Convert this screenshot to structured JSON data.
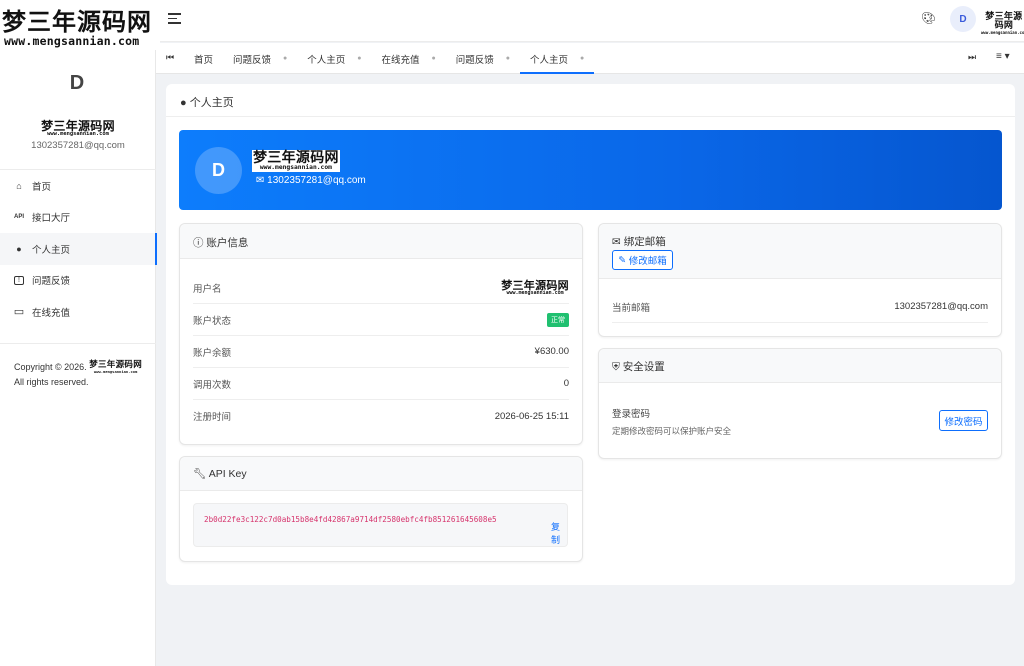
{
  "brand": {
    "main": "梦三年源码网",
    "sub": "www.mengsannian.com",
    "mini_main": "梦三年源码网",
    "mini_sub": "www.mengsannian.com"
  },
  "sidebar": {
    "avatar_letter": "D",
    "email": "1302357281@qq.com",
    "items": [
      {
        "icon": "home-icon",
        "glyph": "⌂",
        "label": "首页"
      },
      {
        "icon": "api-icon",
        "glyph": "API",
        "label": "接口大厅"
      },
      {
        "icon": "user-circle-icon",
        "glyph": "●",
        "label": "个人主页",
        "active": true
      },
      {
        "icon": "feedback-icon",
        "glyph": "!",
        "label": "问题反馈"
      },
      {
        "icon": "card-icon",
        "glyph": "▭",
        "label": "在线充值"
      }
    ],
    "copyright_prefix": "Copyright © 2026.",
    "copyright_suffix": "All rights reserved."
  },
  "topbar": {
    "avatar_letter": "D"
  },
  "tabs": [
    {
      "label": "首页",
      "closable": false
    },
    {
      "label": "问题反馈",
      "closable": true
    },
    {
      "label": "个人主页",
      "closable": true
    },
    {
      "label": "在线充值",
      "closable": true
    },
    {
      "label": "问题反馈",
      "closable": true
    },
    {
      "label": "个人主页",
      "closable": true,
      "active": true
    }
  ],
  "page": {
    "title": "个人主页",
    "hero": {
      "avatar_letter": "D",
      "email": "1302357281@qq.com"
    },
    "account": {
      "title": "账户信息",
      "rows": [
        {
          "label": "用户名",
          "value": ""
        },
        {
          "label": "账户状态",
          "value": "正常"
        },
        {
          "label": "账户余额",
          "value": "¥630.00"
        },
        {
          "label": "调用次数",
          "value": "0"
        },
        {
          "label": "注册时间",
          "value": "2026-06-25 15:11"
        }
      ]
    },
    "apikey": {
      "title": "API Key",
      "key": "2b0d22fe3c122c7d0ab15b8e4fd42867a9714df2580ebfc4fb851261645608e5",
      "copy_label": "复制"
    },
    "email_card": {
      "title": "绑定邮箱",
      "edit_label": "修改邮箱",
      "current_label": "当前邮箱",
      "current_value": "1302357281@qq.com"
    },
    "security": {
      "title": "安全设置",
      "password_label": "登录密码",
      "password_hint": "定期修改密码可以保护账户安全",
      "change_label": "修改密码"
    }
  },
  "colors": {
    "accent": "#0d6efd",
    "hero_start": "#0d7dfc",
    "hero_end": "#0556cf",
    "badge": "#20c070",
    "apikey": "#d6336c"
  }
}
